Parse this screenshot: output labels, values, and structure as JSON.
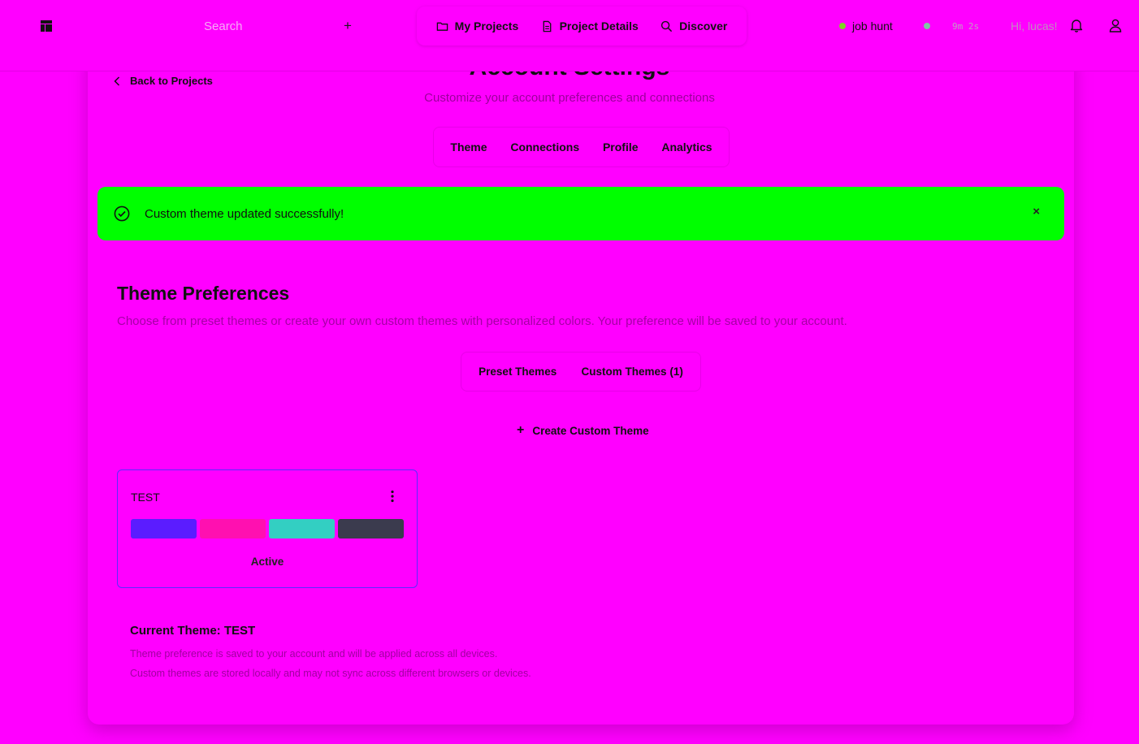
{
  "header": {
    "search_placeholder": "Search",
    "add_symbol": "+",
    "nav": [
      {
        "label": "My Projects",
        "icon": "folder-icon"
      },
      {
        "label": "Project Details",
        "icon": "document-icon"
      },
      {
        "label": "Discover",
        "icon": "search-icon"
      }
    ],
    "status_label": "job hunt",
    "status_color": "#7dd321",
    "timer": "9m 2s",
    "greeting": "Hi, lucas!"
  },
  "page": {
    "back_label": "Back to Projects",
    "title": "Account Settings",
    "subtitle": "Customize your account preferences and connections",
    "tabs": [
      "Theme",
      "Connections",
      "Profile",
      "Analytics"
    ]
  },
  "alert": {
    "message": "Custom theme updated successfully!",
    "close_symbol": "×",
    "color": "#00ff00"
  },
  "theme_section": {
    "title": "Theme Preferences",
    "description": "Choose from preset themes or create your own custom themes with personalized colors. Your preference will be saved to your account.",
    "subtabs": [
      "Preset Themes",
      "Custom Themes (1)"
    ],
    "create_label": "Create Custom Theme",
    "create_symbol": "+"
  },
  "custom_theme": {
    "name": "TEST",
    "swatches": [
      "#5b1cff",
      "#ff10b0",
      "#33cfc2",
      "#3b3b4e"
    ],
    "status": "Active"
  },
  "current_theme": {
    "label": "Current Theme: TEST",
    "notes": [
      "Theme preference is saved to your account and will be applied across all devices.",
      "Custom themes are stored locally and may not sync across different browsers or devices."
    ]
  }
}
